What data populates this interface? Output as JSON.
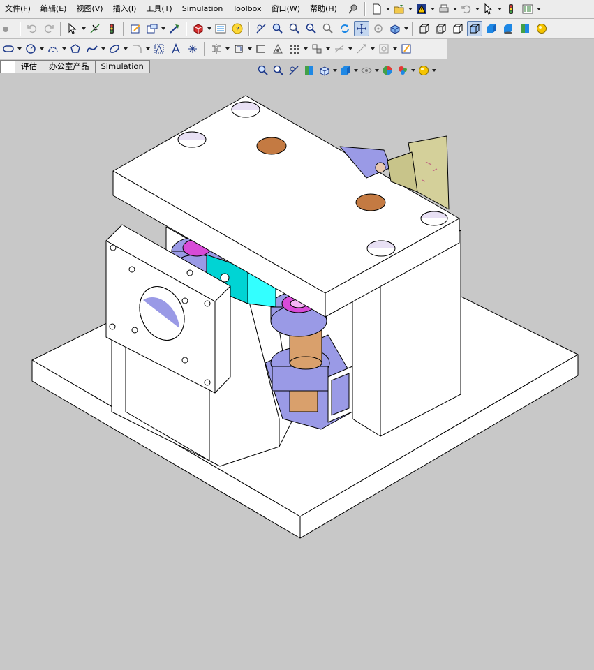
{
  "menu": [
    "文件(F)",
    "编辑(E)",
    "视图(V)",
    "插入(I)",
    "工具(T)",
    "Simulation",
    "Toolbox",
    "窗口(W)",
    "帮助(H)"
  ],
  "tabs": [
    "",
    "评估",
    "办公室产品",
    "Simulation"
  ],
  "colors": {
    "background": "#c8c8c8",
    "part_face": "#ffffff",
    "hole": "#c47a42",
    "cylinder": "#d9a06c",
    "bracket": "#9a9ae6",
    "spring": "#d84bd8",
    "cyan_plate": "#00d4d4",
    "side_plate": "#d4d09a"
  }
}
